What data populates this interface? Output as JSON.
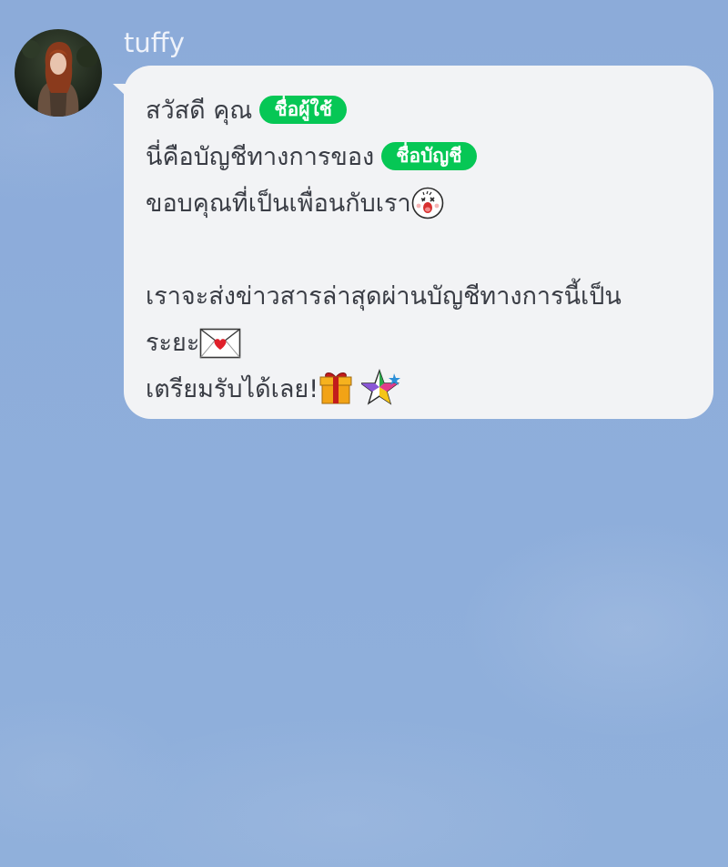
{
  "sender": {
    "name": "tuffy"
  },
  "message": {
    "greeting": "สวัสดี คุณ",
    "username_tag": "ชื่อผู้ใช้",
    "account_line": "นี่คือบัญชีทางการของ",
    "account_tag": "ชื่อบัญชี",
    "thanks_line": "ขอบคุณที่เป็นเพื่อนกับเรา",
    "news_line_1": "เราจะส่งข่าวสารล่าสุดผ่านบัญชีทางการนี้เป็น",
    "news_line_2": "ระยะ",
    "ready_line": "เตรียมรับได้เลย!"
  },
  "icons": {
    "avatar": "user-photo-avatar",
    "thanks_emoji": "sticker-face-emoji",
    "news_emoji": "love-letter-emoji",
    "ready_emoji_1": "gift-box-emoji",
    "ready_emoji_2": "sparkle-star-emoji"
  },
  "colors": {
    "tag_green": "#06c755",
    "bubble": "#f2f3f5",
    "background": "#8eadd9"
  }
}
